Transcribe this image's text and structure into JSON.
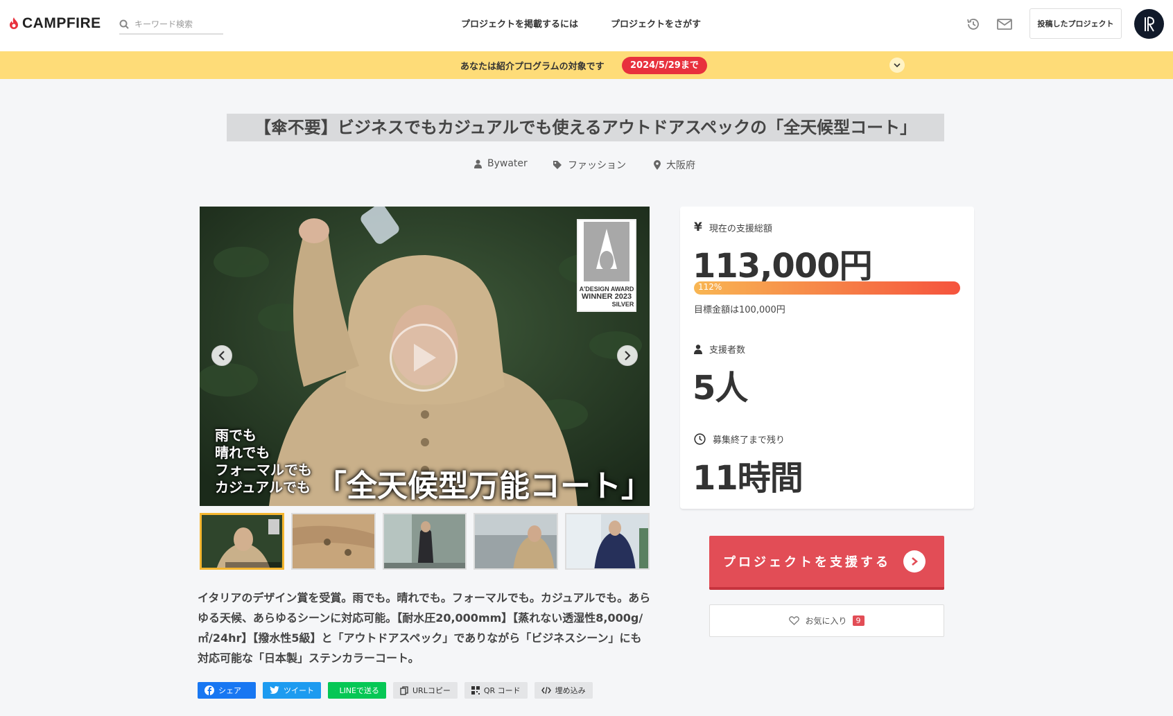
{
  "header": {
    "logo": "CAMPFIRE",
    "search_placeholder": "キーワード検索",
    "nav": [
      "プロジェクトを掲載するには",
      "プロジェクトをさがす"
    ],
    "posted_projects": "投稿したプロジェクト",
    "icons": [
      "history-icon",
      "mail-icon"
    ]
  },
  "banner": {
    "text": "あなたは紹介プログラムの対象です",
    "deadline": "2024/5/29まで"
  },
  "project": {
    "title": "【傘不要】ビジネスでもカジュアルでも使えるアウトドアスペックの「全天候型コート」",
    "owner": "Bywater",
    "category": "ファッション",
    "location": "大阪府",
    "image_overlay_left": [
      "雨でも",
      "晴れでも",
      "フォーマルでも",
      "カジュアルでも"
    ],
    "image_overlay_big": "「全天候型万能コート」",
    "award": [
      "A'DESIGN AWARD",
      "WINNER 2023",
      "SILVER"
    ],
    "thumbnail_count": 5,
    "description": "イタリアのデザイン賞を受賞。雨でも。晴れでも。フォーマルでも。カジュアルでも。あらゆる天候、あらゆるシーンに対応可能。【耐水圧20,000mm】【蒸れない透湿性8,000g/㎡/24hr】【撥水性5級】と「アウトドアスペック」でありながら「ビジネスシーン」にも対応可能な「日本製」ステンカラーコート。"
  },
  "share": {
    "facebook": "シェア",
    "twitter": "ツイート",
    "line": "LINEで送る",
    "url_copy": "URLコピー",
    "qr": "QR コード",
    "embed": "埋め込み"
  },
  "stats": {
    "total_label": "現在の支援総額",
    "total_value": "113,000円",
    "progress_text": "112%",
    "progress_fraction": 1.12,
    "goal": "目標金額は100,000円",
    "supporters_label": "支援者数",
    "supporters_value": "5人",
    "remaining_label": "募集終了まで残り",
    "remaining_value": "11時間"
  },
  "actions": {
    "support": "プロジェクトを支援する",
    "favorite": "お気に入り",
    "favorite_count": "9"
  },
  "colors": {
    "banner": "#fedc78",
    "accent_red": "#e24d56",
    "badge_red": "#e8313d",
    "thumb_active": "#f5b630"
  }
}
